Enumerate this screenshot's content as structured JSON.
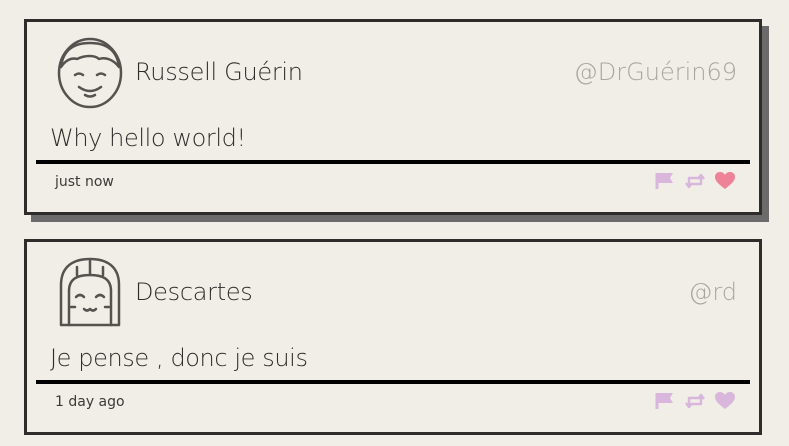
{
  "tweets": [
    {
      "author": "Russell Guérin",
      "handle": "@DrGuérin69",
      "message": "Why hello world!",
      "time": "just now",
      "avatar_icon": "man-face-icon",
      "liked": true
    },
    {
      "author": "Descartes",
      "handle": "@rd",
      "message": "Je pense , donc je suis",
      "time": "1 day ago",
      "avatar_icon": "woman-face-icon",
      "liked": false
    }
  ],
  "colors": {
    "background": "#f1eee7",
    "border": "#2e2d2b",
    "action_icon": "#d9b6db",
    "liked_heart": "#ee8296",
    "handle": "#a8a6a2"
  }
}
